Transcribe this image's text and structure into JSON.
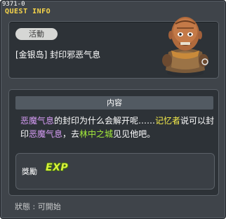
{
  "window": {
    "code": "9371-0",
    "title": "QUEST INFO"
  },
  "quest": {
    "category": "活動",
    "name": "[金银岛] 封印邪恶气息",
    "npc_icon": "old-monk-npc"
  },
  "content": {
    "header": "内容",
    "description": [
      {
        "text": "恶魔气息",
        "style": "purple"
      },
      {
        "text": "的封印为什么会解开呢……",
        "style": "plain"
      },
      {
        "text": "记忆者",
        "style": "yellow"
      },
      {
        "text": "说可以封印",
        "style": "plain"
      },
      {
        "text": "恶魔气息",
        "style": "purple"
      },
      {
        "text": "，去",
        "style": "plain"
      },
      {
        "text": "林中之城",
        "style": "green"
      },
      {
        "text": "见见他吧。",
        "style": "plain"
      }
    ],
    "reward_label": "獎勵",
    "reward_exp": "EXP"
  },
  "status": "狀態 : 可開始",
  "colors": {
    "title": "#f7d54a",
    "purple_keyword": "#d69cf5",
    "yellow_keyword": "#f5ec4a",
    "green_keyword": "#a4ec3a"
  }
}
